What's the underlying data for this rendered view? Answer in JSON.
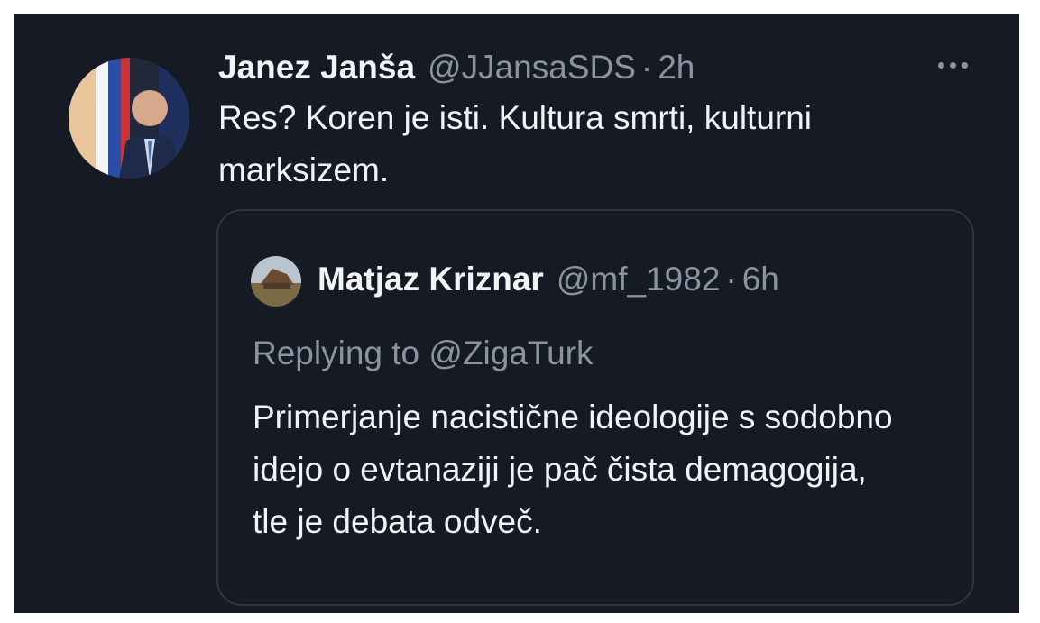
{
  "tweet": {
    "display_name": "Janez Janša",
    "handle": "@JJansaSDS",
    "separator": "·",
    "time": "2h",
    "text": "Res? Koren je isti. Kultura smrti, kulturni marksizem."
  },
  "quoted_tweet": {
    "display_name": "Matjaz Kriznar",
    "handle": "@mf_1982",
    "separator": "·",
    "time": "6h",
    "replying_to": "Replying to @ZigaTurk",
    "text": "Primerjanje nacistične ideologije s sodobno idejo o evtanaziji je pač čista demagogija, tle je debata odveč."
  },
  "icons": {
    "more": "more-options-icon",
    "avatar": "profile-photo",
    "quote_avatar": "profile-photo"
  },
  "colors": {
    "background": "#161a25",
    "text": "#f2f3f5",
    "secondary_text": "#8b949e",
    "border": "#2f3540"
  }
}
